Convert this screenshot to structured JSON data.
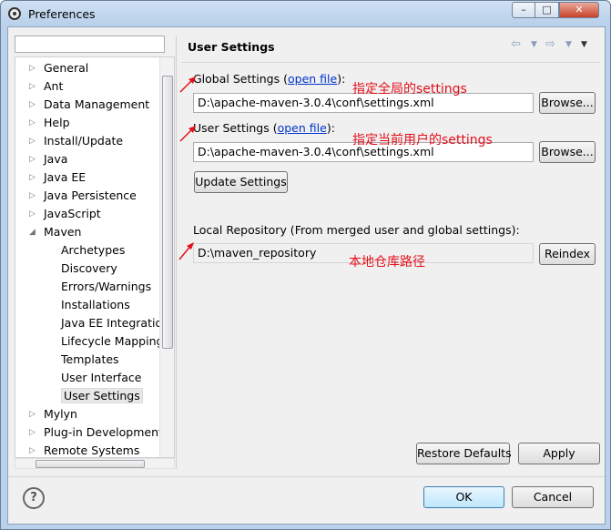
{
  "window": {
    "title": "Preferences"
  },
  "tree": {
    "items": [
      {
        "label": "General",
        "expandable": true
      },
      {
        "label": "Ant",
        "expandable": true
      },
      {
        "label": "Data Management",
        "expandable": true
      },
      {
        "label": "Help",
        "expandable": true
      },
      {
        "label": "Install/Update",
        "expandable": true
      },
      {
        "label": "Java",
        "expandable": true
      },
      {
        "label": "Java EE",
        "expandable": true
      },
      {
        "label": "Java Persistence",
        "expandable": true
      },
      {
        "label": "JavaScript",
        "expandable": true
      },
      {
        "label": "Maven",
        "expanded": true
      },
      {
        "label": "Archetypes",
        "child": true
      },
      {
        "label": "Discovery",
        "child": true
      },
      {
        "label": "Errors/Warnings",
        "child": true
      },
      {
        "label": "Installations",
        "child": true
      },
      {
        "label": "Java EE Integration",
        "child": true
      },
      {
        "label": "Lifecycle Mappings",
        "child": true
      },
      {
        "label": "Templates",
        "child": true
      },
      {
        "label": "User Interface",
        "child": true
      },
      {
        "label": "User Settings",
        "child": true,
        "selected": true
      },
      {
        "label": "Mylyn",
        "expandable": true
      },
      {
        "label": "Plug-in Development",
        "expandable": true
      },
      {
        "label": "Remote Systems",
        "expandable": true
      }
    ]
  },
  "page": {
    "title": "User Settings",
    "global_label": "Global Settings",
    "global_link": "open file",
    "global_path": "D:\\apache-maven-3.0.4\\conf\\settings.xml",
    "user_label": "User Settings",
    "user_link": "open file",
    "user_path": "D:\\apache-maven-3.0.4\\conf\\settings.xml",
    "update_button": "Update Settings",
    "local_repo_label": "Local Repository (From merged user and global settings):",
    "local_repo_path": "D:\\maven_repository",
    "browse_button": "Browse...",
    "reindex_button": "Reindex",
    "restore_defaults": "Restore Defaults",
    "apply": "Apply"
  },
  "annotations": {
    "global": "指定全局的settings",
    "user": "指定当前用户的settings",
    "repo": "本地仓库路径",
    "color": "#e4101a"
  },
  "footer": {
    "ok": "OK",
    "cancel": "Cancel"
  }
}
